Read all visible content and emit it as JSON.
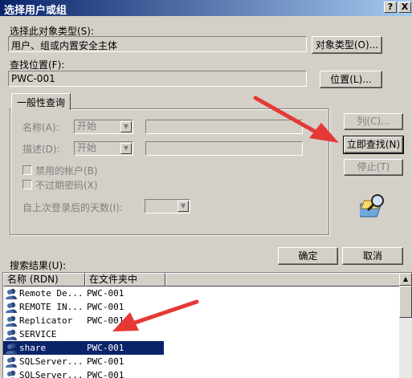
{
  "window": {
    "title": "选择用户或组",
    "help_btn": "?",
    "close_btn": "X"
  },
  "object_type": {
    "label": "选择此对象类型(S):",
    "value": "用户、组或内置安全主体",
    "button": "对象类型(O)..."
  },
  "location": {
    "label": "查找位置(F):",
    "value": "PWC-001",
    "button": "位置(L)..."
  },
  "query": {
    "tab": "一般性查询",
    "name_label": "名称(A):",
    "name_mode": "开始",
    "desc_label": "描述(D):",
    "desc_mode": "开始",
    "disabled_accounts": "禁用的帐户(B)",
    "no_expire_password": "不过期密码(X)",
    "days_since_logon": "自上次登录后的天数(I):"
  },
  "side_buttons": {
    "columns": "列(C)...",
    "find_now": "立即查找(N)",
    "stop": "停止(T)"
  },
  "ok_button": "确定",
  "cancel_button": "取消",
  "results": {
    "label": "搜索结果(U):",
    "columns": [
      "名称 (RDN)",
      "在文件夹中"
    ],
    "rows": [
      {
        "name": "Remote De...",
        "folder": "PWC-001",
        "selected": false
      },
      {
        "name": "REMOTE IN...",
        "folder": "PWC-001",
        "selected": false
      },
      {
        "name": "Replicator",
        "folder": "PWC-001",
        "selected": false
      },
      {
        "name": "SERVICE",
        "folder": "",
        "selected": false
      },
      {
        "name": "share",
        "folder": "PWC-001",
        "selected": true
      },
      {
        "name": "SQLServer...",
        "folder": "PWC-001",
        "selected": false
      },
      {
        "name": "SQLServer...",
        "folder": "PWC-001",
        "selected": false
      }
    ]
  },
  "colors": {
    "dialog_bg": "#d4d0c8",
    "title_start": "#0a246a",
    "title_end": "#a6caf0",
    "selection": "#0a246a",
    "annotation_arrow": "#e53935"
  }
}
